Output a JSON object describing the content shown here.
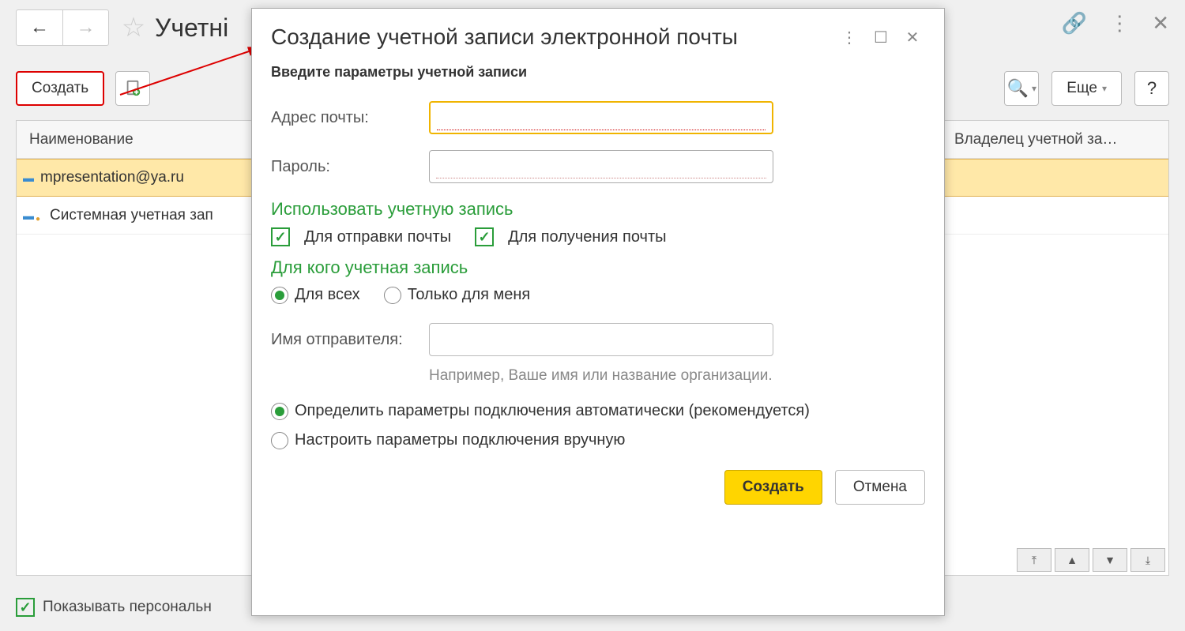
{
  "page": {
    "title_truncated": "Учетні"
  },
  "toolbar": {
    "create": "Создать",
    "more": "Еще",
    "help": "?"
  },
  "list": {
    "header_name": "Наименование",
    "header_owner": "Владелец учетной за…",
    "rows": [
      {
        "icon": "mail-blue",
        "text": "mpresentation@ya.ru",
        "selected": true
      },
      {
        "icon": "mail-system",
        "text": "Системная учетная зап",
        "selected": false
      }
    ]
  },
  "bottom": {
    "show_personal": "Показывать персональн"
  },
  "dialog": {
    "title": "Создание учетной записи электронной почты",
    "subtitle": "Введите параметры учетной записи",
    "email_label": "Адрес почты:",
    "password_label": "Пароль:",
    "use_section": "Использовать учетную запись",
    "use_send": "Для отправки почты",
    "use_receive": "Для получения почты",
    "whom_section": "Для кого учетная запись",
    "whom_all": "Для всех",
    "whom_me": "Только для меня",
    "sender_label": "Имя отправителя:",
    "sender_hint": "Например, Ваше имя или название организации.",
    "conn_auto": "Определить параметры подключения автоматически (рекомендуется)",
    "conn_manual": "Настроить параметры подключения вручную",
    "create_btn": "Создать",
    "cancel_btn": "Отмена"
  }
}
